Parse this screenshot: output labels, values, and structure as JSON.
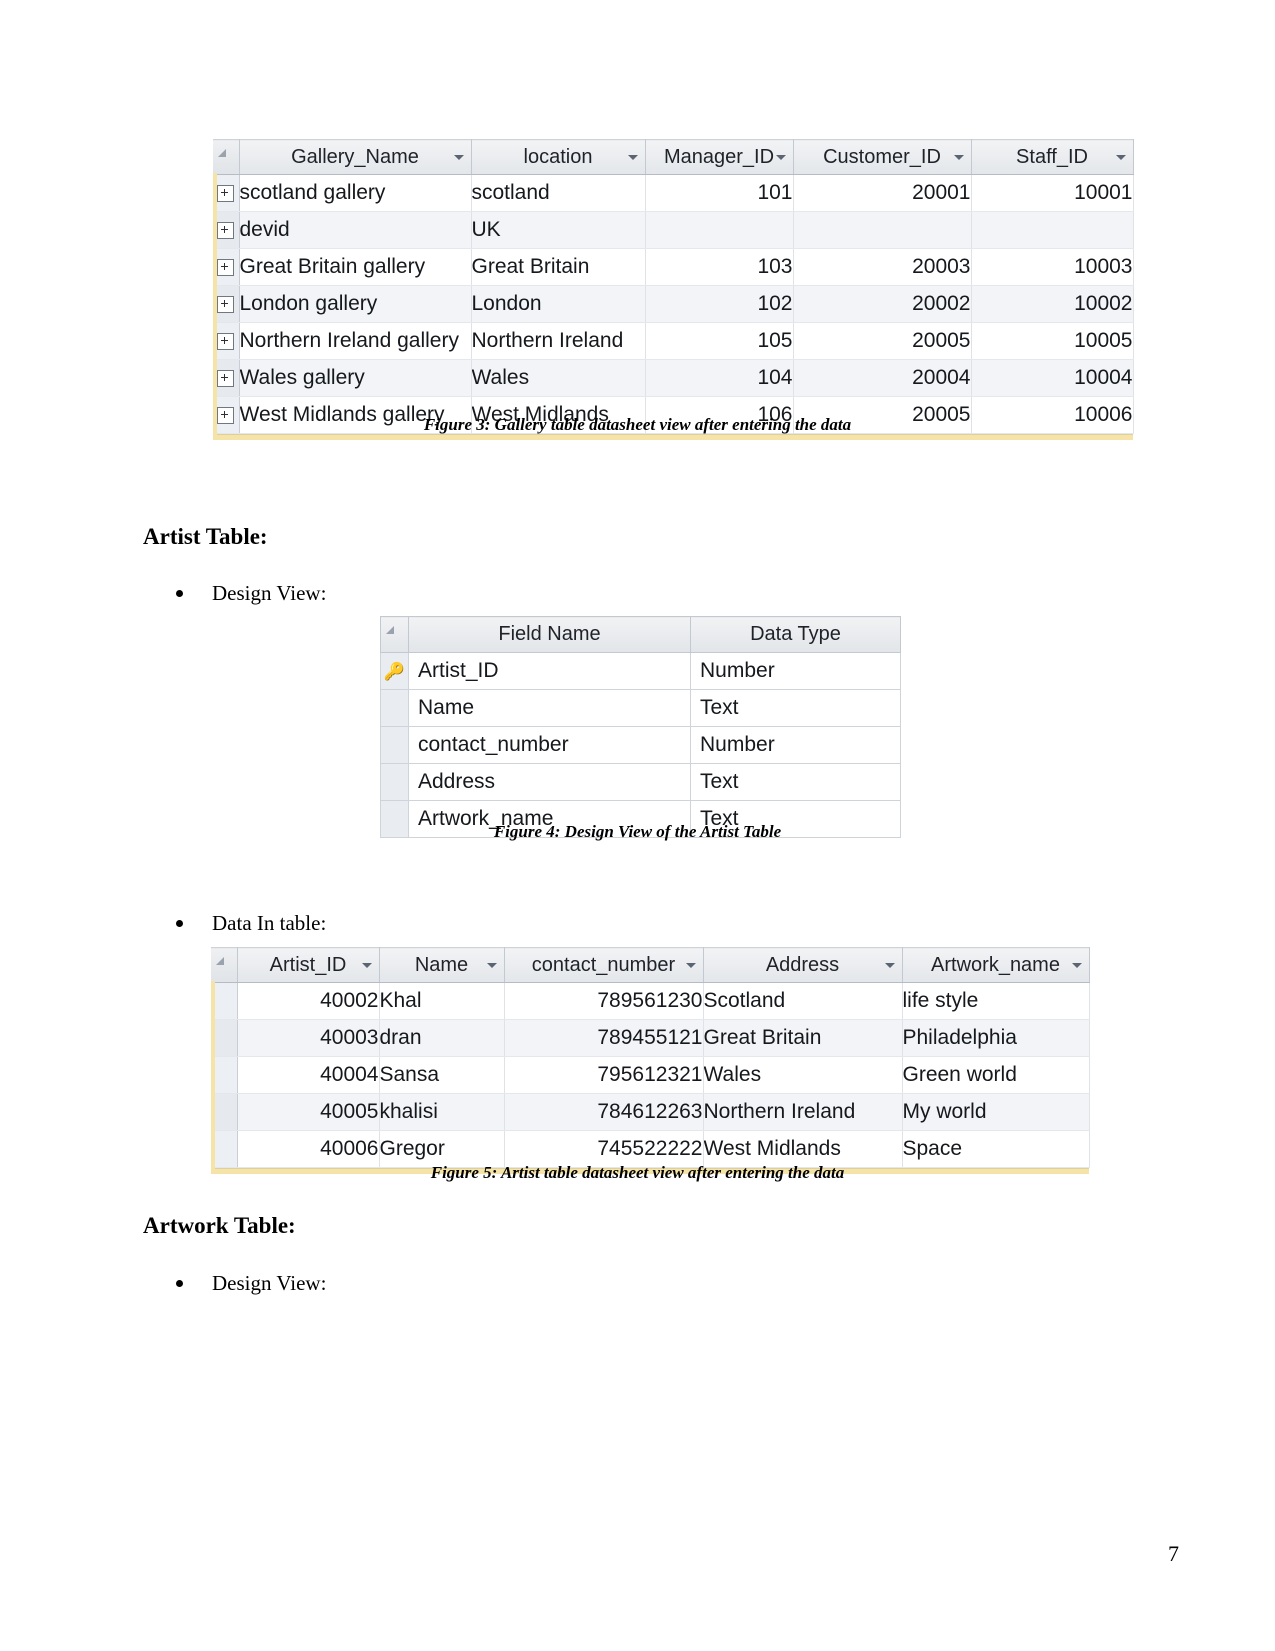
{
  "document": {
    "page_number": "7"
  },
  "figure3": {
    "caption": "Figure 3: Gallery table datasheet view after entering the data",
    "table": {
      "columns": [
        "Gallery_Name",
        "location",
        "Manager_ID",
        "Customer_ID",
        "Staff_ID"
      ],
      "rows": [
        [
          "scotland gallery",
          "scotland",
          "101",
          "20001",
          "10001"
        ],
        [
          "devid",
          "UK",
          "",
          "",
          ""
        ],
        [
          "Great Britain gallery",
          "Great Britain",
          "103",
          "20003",
          "10003"
        ],
        [
          "London gallery",
          "London",
          "102",
          "20002",
          "10002"
        ],
        [
          "Northern Ireland gallery",
          "Northern Ireland",
          "105",
          "20005",
          "10005"
        ],
        [
          "Wales gallery",
          "Wales",
          "104",
          "20004",
          "10004"
        ],
        [
          "West Midlands gallery",
          "West Midlands",
          "106",
          "20005",
          "10006"
        ]
      ]
    }
  },
  "artist_section": {
    "heading": "Artist Table:",
    "bullet_design_view": "Design View:",
    "bullet_data_in_table": "Data In table:"
  },
  "figure4": {
    "caption": "Figure 4: Design View of the Artist Table",
    "table": {
      "columns": [
        "Field Name",
        "Data Type"
      ],
      "rows": [
        {
          "field": "Artist_ID",
          "type": "Number",
          "primary_key": true
        },
        {
          "field": "Name",
          "type": "Text",
          "primary_key": false
        },
        {
          "field": "contact_number",
          "type": "Number",
          "primary_key": false
        },
        {
          "field": "Address",
          "type": "Text",
          "primary_key": false
        },
        {
          "field": "Artwork_name",
          "type": "Text",
          "primary_key": false
        }
      ]
    }
  },
  "figure5": {
    "caption": "Figure 5: Artist table datasheet view after entering the data",
    "table": {
      "columns": [
        "Artist_ID",
        "Name",
        "contact_number",
        "Address",
        "Artwork_name"
      ],
      "rows": [
        [
          "40002",
          "Khal",
          "789561230",
          "Scotland",
          "life style"
        ],
        [
          "40003",
          "dran",
          "789455121",
          "Great Britain",
          "Philadelphia"
        ],
        [
          "40004",
          "Sansa",
          "795612321",
          "Wales",
          "Green world"
        ],
        [
          "40005",
          "khalisi",
          "784612263",
          "Northern Ireland",
          "My world"
        ],
        [
          "40006",
          "Gregor",
          "745522222",
          "West Midlands",
          "Space"
        ]
      ]
    }
  },
  "artwork_section": {
    "heading": "Artwork Table:",
    "bullet_design_view": "Design View:"
  }
}
